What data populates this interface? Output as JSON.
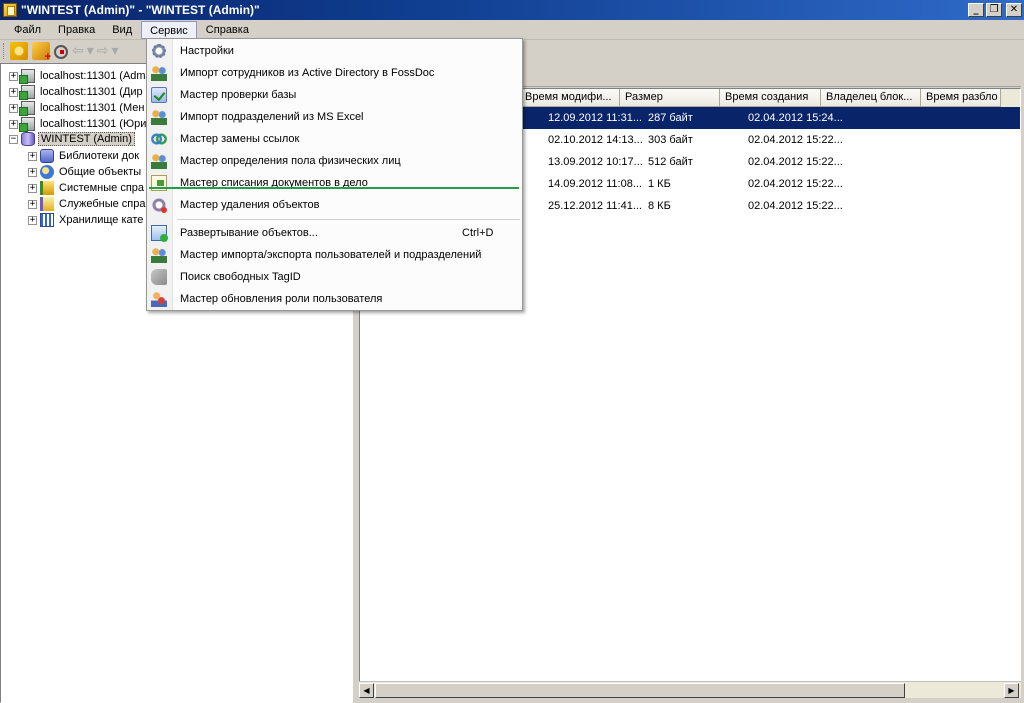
{
  "window": {
    "title": "\"WINTEST (Admin)\" - \"WINTEST (Admin)\"",
    "minimize": "_",
    "restore": "❐",
    "close": "✕"
  },
  "menubar": {
    "items": [
      "Файл",
      "Правка",
      "Вид",
      "Сервис",
      "Справка"
    ],
    "active": "Сервис"
  },
  "toolbar": {
    "icons": [
      "refresh-icon",
      "add-icon",
      "zoom-icon",
      "back-icon",
      "forward-icon"
    ]
  },
  "tree": {
    "nodes": [
      {
        "label": "localhost:11301 (Adm",
        "icon": "server-icon",
        "expander": "+"
      },
      {
        "label": "localhost:11301 (Дир",
        "icon": "server-icon",
        "expander": "+"
      },
      {
        "label": "localhost:11301 (Мен",
        "icon": "server-icon",
        "expander": "+"
      },
      {
        "label": "localhost:11301 (Юри",
        "icon": "server-icon",
        "expander": "+"
      },
      {
        "label": "WINTEST (Admin)",
        "icon": "database-icon",
        "expander": "−"
      },
      {
        "label": "Библиотеки док",
        "icon": "library-icon",
        "expander": "+"
      },
      {
        "label": "Общие объекты",
        "icon": "common-objects-icon",
        "expander": "+"
      },
      {
        "label": "Системные спра",
        "icon": "system-reference-icon",
        "expander": "+"
      },
      {
        "label": "Служебные спра",
        "icon": "service-reference-icon",
        "expander": "+"
      },
      {
        "label": "Хранилище кате",
        "icon": "storage-icon",
        "expander": "+"
      }
    ]
  },
  "table": {
    "sort_indicator": "△",
    "columns": [
      "Время модифи...",
      "Размер",
      "Время создания",
      "Владелец блок...",
      "Время разбло"
    ],
    "rows": [
      [
        "12.09.2012 11:31...",
        "287 байт",
        "02.04.2012 15:24...",
        "",
        ""
      ],
      [
        "02.10.2012 14:13...",
        "303 байт",
        "02.04.2012 15:22...",
        "",
        ""
      ],
      [
        "13.09.2012 10:17...",
        "512 байт",
        "02.04.2012 15:22...",
        "",
        ""
      ],
      [
        "14.09.2012 11:08...",
        "1 КБ",
        "02.04.2012 15:22...",
        "",
        ""
      ],
      [
        "25.12.2012 11:41...",
        "8 КБ",
        "02.04.2012 15:22...",
        "",
        ""
      ]
    ],
    "selected_row": 0
  },
  "scrollbar": {
    "left": "◀",
    "right": "▶"
  },
  "service_menu": {
    "items": [
      {
        "label": "Настройки",
        "icon": "gear-icon",
        "shortcut": ""
      },
      {
        "label": "Импорт сотрудников из Active Directory в FossDoc",
        "icon": "import-users-icon",
        "shortcut": ""
      },
      {
        "label": "Мастер проверки базы",
        "icon": "check-database-icon",
        "shortcut": ""
      },
      {
        "label": "Импорт подразделений из MS Excel",
        "icon": "import-departments-icon",
        "shortcut": ""
      },
      {
        "label": "Мастер замены ссылок",
        "icon": "replace-links-icon",
        "shortcut": ""
      },
      {
        "label": "Мастер определения пола физических лиц",
        "icon": "gender-wizard-icon",
        "shortcut": ""
      },
      {
        "label": "Мастер списания документов в дело",
        "icon": "archive-documents-icon",
        "shortcut": ""
      },
      {
        "label": "Мастер удаления объектов",
        "icon": "delete-objects-icon",
        "shortcut": ""
      },
      {
        "label": "Развертывание объектов...",
        "icon": "deploy-objects-icon",
        "shortcut": "Ctrl+D"
      },
      {
        "label": "Мастер импорта/экспорта пользователей и подразделений",
        "icon": "import-export-users-icon",
        "shortcut": ""
      },
      {
        "label": "Поиск свободных TagID",
        "icon": "tag-search-icon",
        "shortcut": ""
      },
      {
        "label": "Мастер обновления роли пользователя",
        "icon": "update-role-icon",
        "shortcut": ""
      }
    ]
  }
}
